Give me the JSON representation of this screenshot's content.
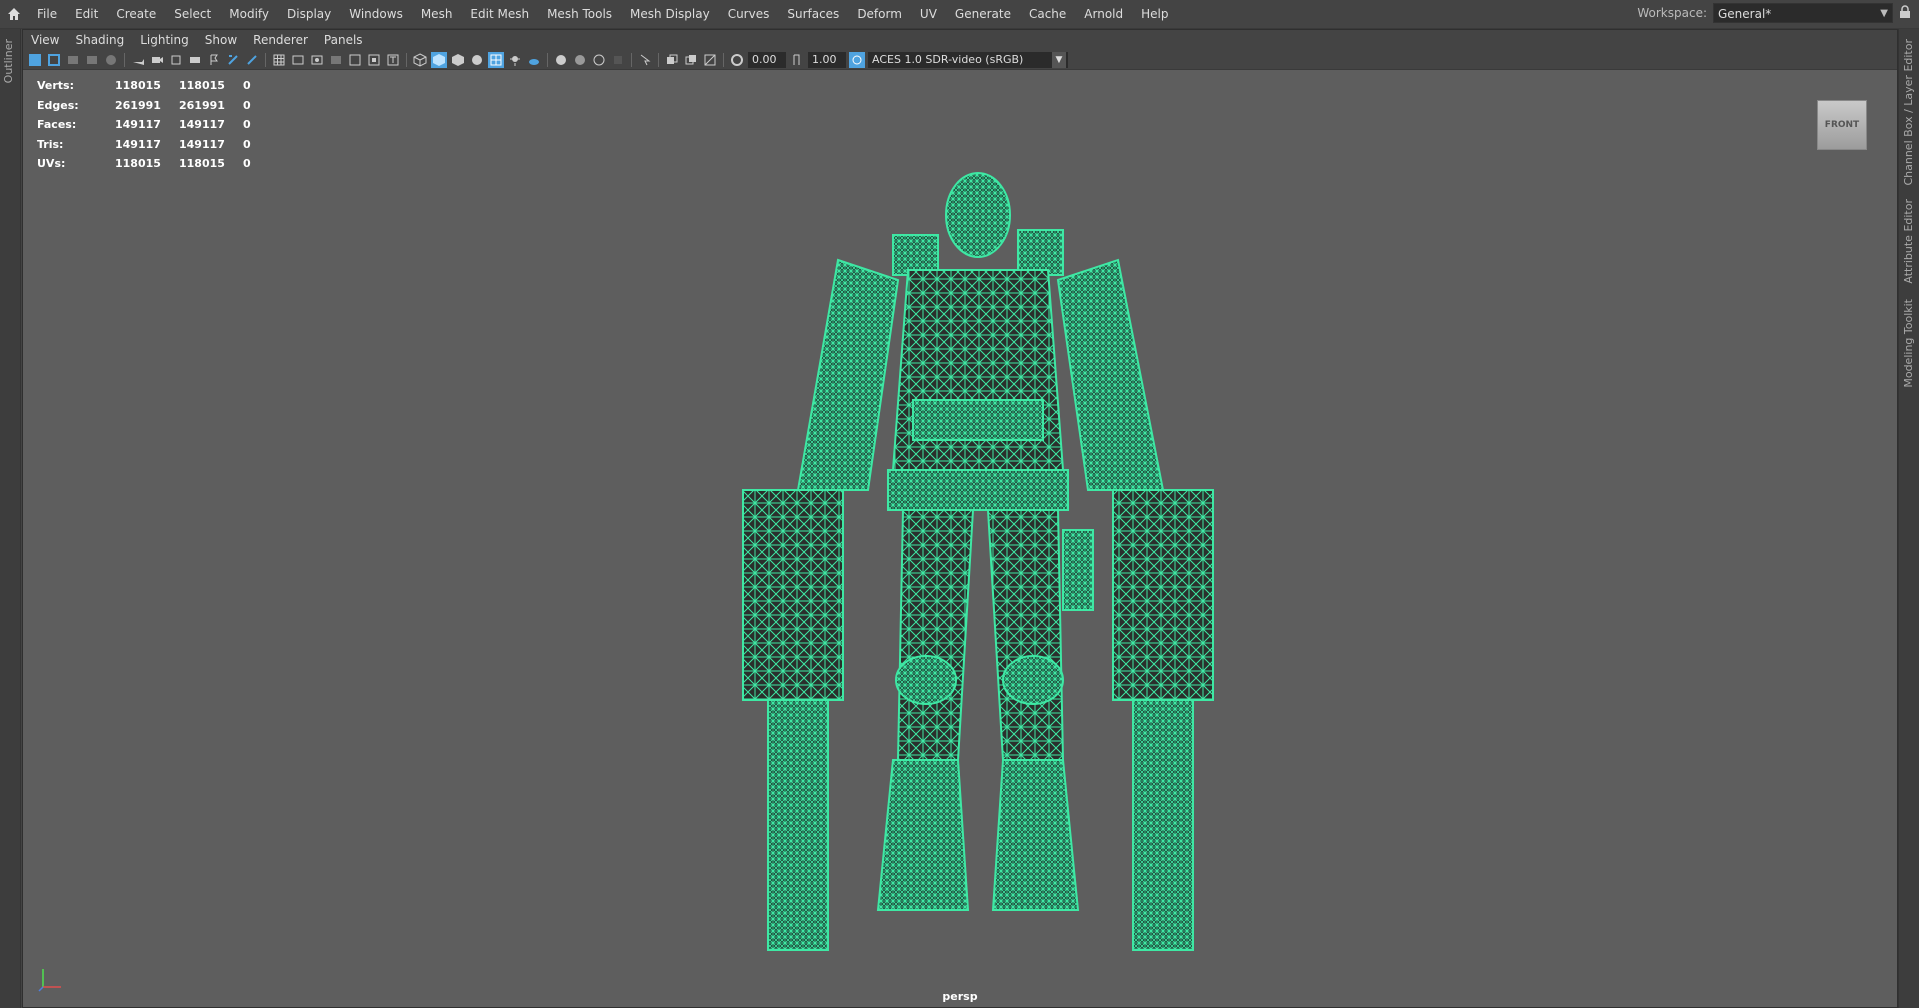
{
  "menubar": {
    "items": [
      "File",
      "Edit",
      "Create",
      "Select",
      "Modify",
      "Display",
      "Windows",
      "Mesh",
      "Edit Mesh",
      "Mesh Tools",
      "Mesh Display",
      "Curves",
      "Surfaces",
      "Deform",
      "UV",
      "Generate",
      "Cache",
      "Arnold",
      "Help"
    ],
    "workspace_label": "Workspace:",
    "workspace_value": "General*"
  },
  "left_strip": {
    "tab": "Outliner"
  },
  "right_strip": {
    "tabs": [
      "Channel Box / Layer Editor",
      "Attribute Editor",
      "Modeling Toolkit"
    ]
  },
  "panel": {
    "menus": [
      "View",
      "Shading",
      "Lighting",
      "Show",
      "Renderer",
      "Panels"
    ],
    "toolbar": {
      "exposure": "0.00",
      "gamma": "1.00",
      "colorspace": "ACES 1.0 SDR-video (sRGB)"
    },
    "hud": [
      {
        "label": "Verts:",
        "v1": "118015",
        "v2": "118015",
        "v3": "0"
      },
      {
        "label": "Edges:",
        "v1": "261991",
        "v2": "261991",
        "v3": "0"
      },
      {
        "label": "Faces:",
        "v1": "149117",
        "v2": "149117",
        "v3": "0"
      },
      {
        "label": "Tris:",
        "v1": "149117",
        "v2": "149117",
        "v3": "0"
      },
      {
        "label": "UVs:",
        "v1": "118015",
        "v2": "118015",
        "v3": "0"
      }
    ],
    "view_cube": "FRONT",
    "camera": "persp"
  },
  "colors": {
    "wireframe": "#3ee8a4",
    "viewport_bg": "#5e5e5e",
    "ui_bg": "#444444"
  }
}
